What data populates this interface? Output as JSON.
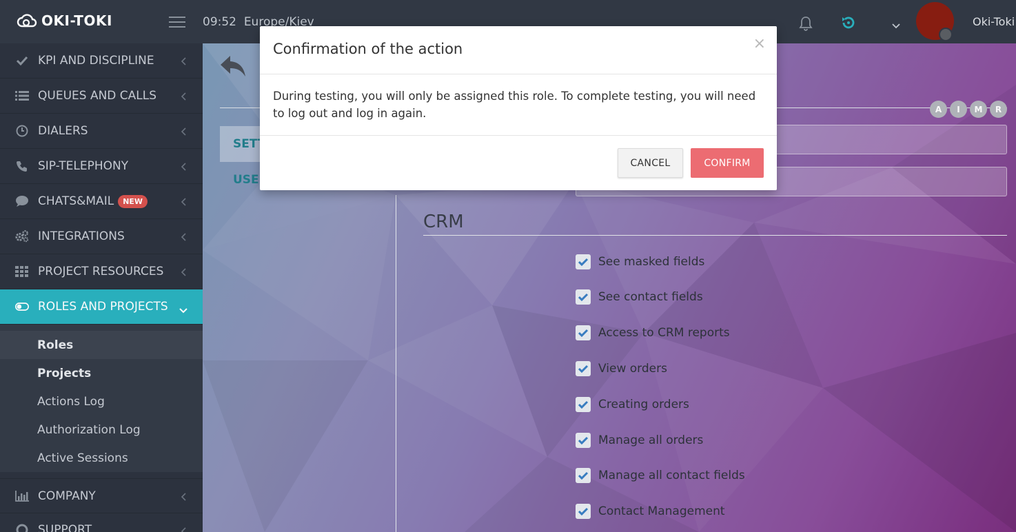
{
  "app": {
    "logo_text": "OKI-TOKI"
  },
  "header": {
    "time": "09:52",
    "timezone": "Europe/Kiev",
    "username": "Oki-Toki"
  },
  "sidebar": {
    "items": [
      {
        "label": "KPI AND DISCIPLINE",
        "icon": "check-icon"
      },
      {
        "label": "QUEUES AND CALLS",
        "icon": "list-icon"
      },
      {
        "label": "DIALERS",
        "icon": "clock-icon"
      },
      {
        "label": "SIP-TELEPHONY",
        "icon": "phone-icon"
      },
      {
        "label": "CHATS&MAIL",
        "icon": "chat-icon",
        "badge": "NEW"
      },
      {
        "label": "INTEGRATIONS",
        "icon": "gears-icon"
      },
      {
        "label": "PROJECT RESOURCES",
        "icon": "grid-icon"
      },
      {
        "label": "ROLES AND PROJECTS",
        "icon": "toggle-icon",
        "active": true
      }
    ],
    "subitems": [
      "Roles",
      "Projects",
      "Actions Log",
      "Authorization Log",
      "Active Sessions"
    ],
    "after": [
      {
        "label": "COMPANY",
        "icon": "bar-chart-icon"
      },
      {
        "label": "SUPPORT",
        "icon": "lifebuoy-icon"
      }
    ]
  },
  "main": {
    "tabs": [
      "SETT",
      "USEF"
    ],
    "access_letters": [
      "A",
      "I",
      "M",
      "R"
    ],
    "section_title": "CRM",
    "permissions": [
      "See masked fields",
      "See contact fields",
      "Access to CRM reports",
      "View orders",
      "Creating orders",
      "Manage all orders",
      "Manage all contact fields",
      "Contact Management"
    ]
  },
  "modal": {
    "title": "Confirmation of the action",
    "close_glyph": "×",
    "body": "During testing, you will only be assigned this role. To complete testing, you will need to log out and log in again.",
    "cancel_label": "CANCEL",
    "confirm_label": "CONFIRM"
  },
  "colors": {
    "accent": "#2ab3c0",
    "confirm": "#ec6c72",
    "sidebar_bg": "#2d3440",
    "badge": "#d9534f"
  }
}
